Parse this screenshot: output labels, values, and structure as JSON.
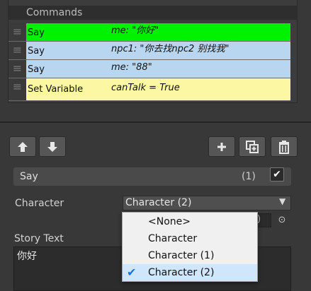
{
  "commands_panel": {
    "header": "Commands",
    "rows": [
      {
        "name": "Say",
        "summary": "me: \"你好\"",
        "color": "#00f200"
      },
      {
        "name": "Say",
        "summary": "npc1: \"你去找npc2 别找我\"",
        "color": "#b8d6ef"
      },
      {
        "name": "Say",
        "summary": "me: \"88\"",
        "color": "#b8d6ef"
      },
      {
        "name": "Set Variable",
        "summary": "canTalk = True",
        "color": "#fcf7a3"
      }
    ]
  },
  "toolbar": {
    "icons": [
      "arrow-up-icon",
      "arrow-down-icon",
      "plus-icon",
      "duplicate-icon",
      "trash-icon"
    ]
  },
  "inspector": {
    "command_title": "Say",
    "command_count": "(1)",
    "enabled": true,
    "character_label": "Character",
    "character_value": "Character (2)",
    "hidden_field_suffix": ")",
    "story_text_label": "Story Text",
    "story_text": "你好"
  },
  "dropdown": {
    "options": [
      "<None>",
      "Character",
      "Character (1)",
      "Character (2)"
    ],
    "selected_index": 3,
    "accent": "#1e73d8"
  }
}
